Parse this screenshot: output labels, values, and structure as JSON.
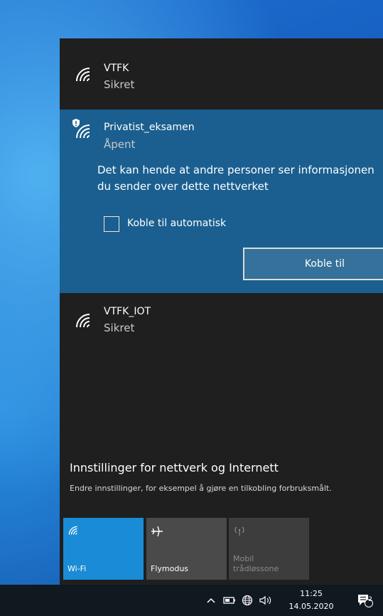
{
  "networks": {
    "first": {
      "name": "VTFK",
      "status": "Sikret"
    },
    "selected": {
      "name": "Privatist_eksamen",
      "status": "Åpent",
      "warning": "Det kan hende at andre personer ser informasjonen du sender over dette nettverket",
      "auto_connect_label": "Koble til automatisk",
      "connect_label": "Koble til"
    },
    "third": {
      "name": "VTFK_IOT",
      "status": "Sikret"
    }
  },
  "settings": {
    "title": "Innstillinger for nettverk og Internett",
    "description": "Endre innstillinger, for eksempel å gjøre en tilkobling forbruksmålt."
  },
  "quick_actions": [
    {
      "label": "Wi-Fi",
      "icon": "wifi-icon",
      "active": true
    },
    {
      "label": "Flymodus",
      "icon": "airplane-icon",
      "active": false
    },
    {
      "label": "Mobil trådløssone",
      "icon": "mobile-hotspot-icon",
      "active": false
    }
  ],
  "taskbar": {
    "time": "11:25",
    "date": "14.05.2020",
    "notification_count": "2"
  },
  "colors": {
    "panel": "#1f1f1f",
    "selected": "#1a5f8f",
    "accent": "#1a8bd6"
  }
}
